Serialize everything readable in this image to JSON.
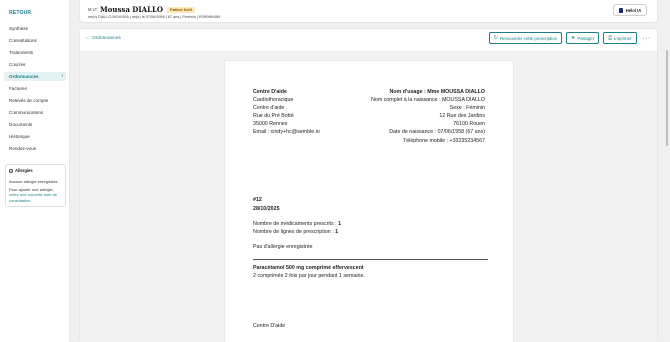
{
  "sidebar": {
    "back_label": "RETOUR",
    "items": [
      {
        "label": "Synthèse"
      },
      {
        "label": "Consultations"
      },
      {
        "label": "Traitements"
      },
      {
        "label": "Courrier"
      },
      {
        "label": "Ordonnances",
        "active": true
      },
      {
        "label": "Factures"
      },
      {
        "label": "Relevés de compte"
      },
      {
        "label": "Communications"
      },
      {
        "label": "Documents"
      },
      {
        "label": "Historique"
      },
      {
        "label": "Rendez-vous"
      }
    ],
    "allergies": {
      "title": "Allergies",
      "none_text": "Aucune allergie enregistrée",
      "add_text": "Pour ajouter une allergie,",
      "link_text": "créez une nouvelle note de consultation."
    }
  },
  "header": {
    "civility": "M LT.",
    "name": "Moussa DIALLO",
    "badge": "Patient fictif",
    "info": "né(e) DIALLO MOUSSA  |  né(e) le 07/06/1958  |  67 ans  |  Féminin  |  E0R9NN469",
    "ia_button": "Helol IA"
  },
  "toolbar": {
    "breadcrumb": "Ordonnances",
    "renew_label": "Renouveler cette prescription",
    "share_label": "Partager",
    "print_label": "Imprimer",
    "more_label": "···"
  },
  "document": {
    "left": {
      "title": "Centre D'aide",
      "specialty": "Cardiothoracique",
      "name": "Centre d'aide",
      "street": "Rue du Pré Botté",
      "city": "35000 Rennes",
      "email": "Email : cindy+hc@semble.io"
    },
    "right": {
      "usage_name": "Nom d'usage : Mme MOUSSA DIALLO",
      "birth_name": "Nom complet à la naissance : MOUSSA DIALLO",
      "sex": "Sexe : Féminin",
      "street": "12 Rue des Jardins",
      "city": "76100 Rouen",
      "birth_date": "Date de naissance : 07/06/1958 (67 ans)",
      "phone": "Téléphone mobile : +33235234567"
    },
    "number": "#12",
    "date": "28/10/2025",
    "med_count_label": "Nombre de médicaments prescrits : ",
    "med_count": "1",
    "line_count_label": "Nombre de lignes de prescription : ",
    "line_count": "1",
    "allergy_note": "Pas d'allergie enregistrée",
    "medication": {
      "name": "Paracétamol 500 mg comprimé effervescent",
      "dosage": "2 comprimés 2 fois par jour pendant 1 semaine."
    },
    "signature": "Centre D'aide"
  },
  "colors": {
    "accent": "#1a7f86",
    "badge_bg": "#fde6ba"
  }
}
